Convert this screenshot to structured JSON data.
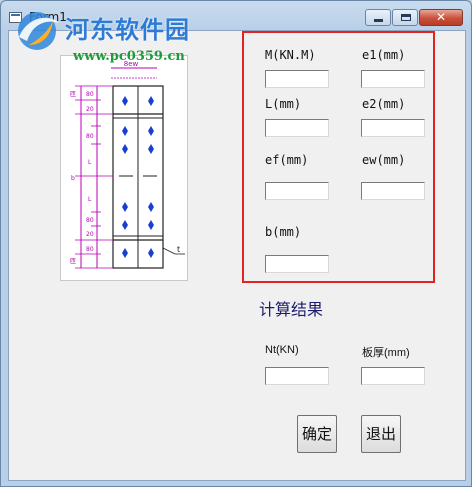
{
  "window": {
    "title": "Form1"
  },
  "watermark": {
    "site_name": "河东软件园",
    "url": "www.pc0359.cn"
  },
  "caption_buttons": {
    "close_glyph": "✕"
  },
  "params": {
    "M_label": "M(KN.M)",
    "e1_label": "e1(mm)",
    "L_label": "L(mm)",
    "e2_label": "e2(mm)",
    "ef_label": "ef(mm)",
    "ew_label": "ew(mm)",
    "b_label": "b(mm)"
  },
  "results": {
    "title": "计算结果",
    "nt_label": "Nt(KN)",
    "thickness_label": "板厚(mm)"
  },
  "buttons": {
    "ok": "确定",
    "exit": "退出"
  },
  "diagram": {
    "top_dim": "8ew",
    "side_mark": "t",
    "left_labels": [
      "匝",
      "80",
      "20",
      "80",
      "L",
      "b",
      "L",
      "80",
      "20",
      "80",
      "匝"
    ]
  },
  "colors": {
    "frame_red": "#e02424",
    "bolt_blue": "#1a3fd0",
    "dim_magenta": "#b800b8"
  }
}
